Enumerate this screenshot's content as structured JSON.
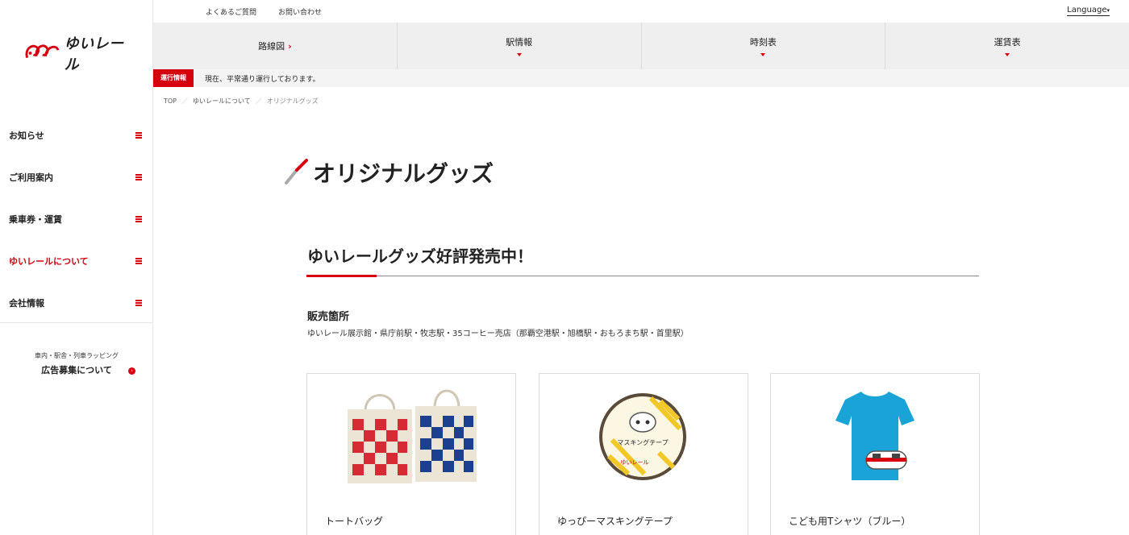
{
  "brand": {
    "logo_text": "ゆいレール"
  },
  "util_nav": {
    "faq": "よくあるご質問",
    "contact": "お問い合わせ",
    "language": "Language"
  },
  "global_nav": [
    {
      "label": "路線図"
    },
    {
      "label": "駅情報"
    },
    {
      "label": "時刻表"
    },
    {
      "label": "運賃表"
    }
  ],
  "operation": {
    "badge": "運行情報",
    "status": "現在、平常通り運行しております。"
  },
  "breadcrumb": {
    "home": "TOP",
    "parent": "ゆいレールについて",
    "current": "オリジナルグッズ"
  },
  "sidebar": {
    "items": [
      {
        "label": "お知らせ"
      },
      {
        "label": "ご利用案内"
      },
      {
        "label": "乗車券・運賃"
      },
      {
        "label": "ゆいレールについて"
      },
      {
        "label": "会社情報"
      }
    ],
    "ad": {
      "small": "車内・駅舎・列車ラッピング",
      "main": "広告募集について"
    }
  },
  "page": {
    "title": "オリジナルグッズ",
    "section_title": "ゆいレールグッズ好評発売中！",
    "sales_heading": "販売箇所",
    "sales_text": "ゆいレール展示館・県庁前駅・牧志駅・35コーヒー売店（那覇空港駅・旭橋駅・おもろまち駅・首里駅）"
  },
  "products": [
    {
      "name": "トートバッグ"
    },
    {
      "name": "ゆっぴーマスキングテープ"
    },
    {
      "name": "こども用Tシャツ（ブルー）"
    }
  ],
  "colors": {
    "accent": "#d7000f",
    "nav_bg": "#efefef",
    "tshirt": "#1aa3d6"
  }
}
